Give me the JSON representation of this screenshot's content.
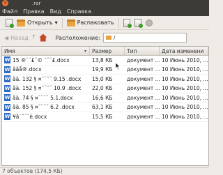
{
  "window": {
    "close_glyph": "×",
    "title": ".rar"
  },
  "menu": [
    "Файл",
    "Правка",
    "Вид",
    "Справка"
  ],
  "toolbar": {
    "open_label": "Открыть",
    "open_arrow": "▾",
    "extract_label": "Распаковать"
  },
  "location": {
    "back_label": "Назад",
    "up_glyph": "↑",
    "label": "Расположение:",
    "value": "/"
  },
  "table": {
    "columns": [
      "Имя",
      "Размер",
      "Тип",
      "Дата изменени"
    ],
    "sort_arrow": "▾",
    "rows": [
      {
        "icon": "W",
        "name": "15 ®¨´£¨© ¯¨¨£.docx",
        "size": "13,8 КБ",
        "type": "документ ...",
        "date": "10 Июнь 2010, ..."
      },
      {
        "icon": "W",
        "name": "ââå®.docx",
        "size": "19,9 КБ",
        "type": "документ ...",
        "date": "10 Июнь 2010, ..."
      },
      {
        "icon": "W",
        "name": "âà. 132 § ¤¯¨¯¨ 9.15 .docx",
        "size": "15,0 КБ",
        "type": "документ ...",
        "date": "10 Июнь 2010, ..."
      },
      {
        "icon": "W",
        "name": "âà. 152 § ¤¯¨¯¨ 10.9 .docx",
        "size": "22,0 КБ",
        "type": "документ ...",
        "date": "10 Июнь 2010, ..."
      },
      {
        "icon": "W",
        "name": "âà. 74 § ¤¯¨¯¨ 5.1.docx",
        "size": "16,6 КБ",
        "type": "документ ...",
        "date": "10 Июнь 2010, ..."
      },
      {
        "icon": "W",
        "name": "âà. 85 § ¤¯¨¯¨ 6.2 .docx",
        "size": "63,1 КБ",
        "type": "документ ...",
        "date": "10 Июнь 2010, ..."
      },
      {
        "icon": "W",
        "name": "¥â¨¯¨¨è.docx",
        "size": "15,5 КБ",
        "type": "документ ...",
        "date": "10 Июнь 2010, ..."
      }
    ]
  },
  "status": "7 объектов (174,5 КБ)"
}
